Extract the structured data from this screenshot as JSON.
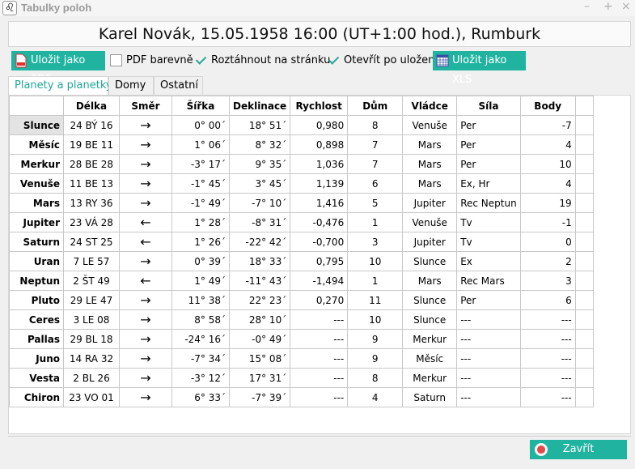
{
  "window": {
    "title": "Tabulky poloh",
    "app_icon_glyph": "♌",
    "min_glyph": "–",
    "max_glyph": "+",
    "close_glyph": "×"
  },
  "header": {
    "text": "Karel Novák, 15.05.1958 16:00 (UT+1:00 hod.), Rumburk"
  },
  "toolbar": {
    "save_pdf_label": "Uložit jako PDF",
    "pdf_color_label": "PDF barevně",
    "pdf_color_checked": false,
    "stretch_label": "Roztáhnout na stránku",
    "stretch_checked": true,
    "open_after_label": "Otevřít po uložení",
    "open_after_checked": true,
    "save_xls_label": "Uložit jako XLS"
  },
  "tabs": [
    {
      "label": "Planety a planetky",
      "active": true
    },
    {
      "label": "Domy",
      "active": false
    },
    {
      "label": "Ostatní",
      "active": false
    }
  ],
  "table": {
    "columns": [
      "",
      "Délka",
      "Směr",
      "Šířka",
      "Deklinace",
      "Rychlost",
      "Dům",
      "Vládce",
      "Síla",
      "Body"
    ],
    "rows": [
      [
        "Slunce",
        "24 BÝ 16",
        "→",
        "0° 00´",
        "18° 51´",
        "0,980",
        "8",
        "Venuše",
        "Per",
        "-7"
      ],
      [
        "Měsíc",
        "19 BE 11",
        "→",
        "1° 06´",
        "8° 32´",
        "0,898",
        "7",
        "Mars",
        "Per",
        "4"
      ],
      [
        "Merkur",
        "28 BE 28",
        "→",
        "-3° 17´",
        "9° 35´",
        "1,036",
        "7",
        "Mars",
        "Per",
        "10"
      ],
      [
        "Venuše",
        "11 BE 13",
        "→",
        "-1° 45´",
        "3° 45´",
        "1,139",
        "6",
        "Mars",
        "Ex, Hr",
        "4"
      ],
      [
        "Mars",
        "13 RY 36",
        "→",
        "-1° 49´",
        "-7° 10´",
        "1,416",
        "5",
        "Jupiter",
        "Rec Neptun",
        "19"
      ],
      [
        "Jupiter",
        "23 VÁ 28",
        "←",
        "1° 28´",
        "-8° 31´",
        "-0,476",
        "1",
        "Venuše",
        "Tv",
        "-1"
      ],
      [
        "Saturn",
        "24 ST 25",
        "←",
        "1° 26´",
        "-22° 42´",
        "-0,700",
        "3",
        "Jupiter",
        "Tv",
        "0"
      ],
      [
        "Uran",
        "7 LE 57",
        "→",
        "0° 39´",
        "18° 33´",
        "0,795",
        "10",
        "Slunce",
        "Ex",
        "2"
      ],
      [
        "Neptun",
        "2 ŠT 49",
        "←",
        "1° 49´",
        "-11° 43´",
        "-1,494",
        "1",
        "Mars",
        "Rec Mars",
        "3"
      ],
      [
        "Pluto",
        "29 LE 47",
        "→",
        "11° 38´",
        "22° 23´",
        "0,270",
        "11",
        "Slunce",
        "Per",
        "6"
      ],
      [
        "Ceres",
        "3 LE 08",
        "→",
        "8° 58´",
        "28° 10´",
        "---",
        "10",
        "Slunce",
        "---",
        "---"
      ],
      [
        "Pallas",
        "29 BL 18",
        "→",
        "-24° 16´",
        "-0° 49´",
        "---",
        "9",
        "Merkur",
        "---",
        "---"
      ],
      [
        "Juno",
        "14 RA 32",
        "→",
        "-7° 34´",
        "15° 08´",
        "---",
        "9",
        "Měsíc",
        "---",
        "---"
      ],
      [
        "Vesta",
        "2 BL 26",
        "→",
        "-3° 12´",
        "17° 31´",
        "---",
        "8",
        "Merkur",
        "---",
        "---"
      ],
      [
        "Chiron",
        "23 VO 01",
        "→",
        "6° 33´",
        "-7° 39´",
        "---",
        "4",
        "Saturn",
        "---",
        "---"
      ]
    ],
    "selected_row": 0
  },
  "footer": {
    "close_label": "Zavřít"
  },
  "colors": {
    "accent": "#1fb3a0",
    "accent_text": "#1fa597"
  }
}
